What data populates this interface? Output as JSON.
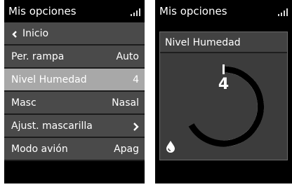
{
  "left_screen": {
    "title": "Mis opciones",
    "signal_icon": "signal-bars-icon",
    "menu": [
      {
        "id": "back",
        "label": "Inicio",
        "icon": "chevron-left-icon"
      },
      {
        "id": "ramp",
        "label": "Per. rampa",
        "value": "Auto"
      },
      {
        "id": "humidity",
        "label": "Nivel Humedad",
        "value": "4",
        "selected": true
      },
      {
        "id": "mask",
        "label": "Masc",
        "value": "Nasal"
      },
      {
        "id": "mask-fit",
        "label": "Ajust. mascarilla",
        "icon": "chevron-right-icon"
      },
      {
        "id": "airplane",
        "label": "Modo avión",
        "value": "Apag"
      }
    ]
  },
  "right_screen": {
    "title": "Mis opciones",
    "signal_icon": "signal-bars-icon",
    "panel": {
      "title": "Nivel Humedad",
      "value": "4",
      "icon": "water-drop-icon",
      "level_fraction": 0.667
    }
  },
  "colors": {
    "screen_bg": "#000000",
    "menu_item_bg": "#4a4a4a",
    "menu_item_selected_bg": "#a8a8a8",
    "panel_bg": "#3c3c3c",
    "gauge_fill": "#000000",
    "gauge_track": "#ffffff"
  }
}
